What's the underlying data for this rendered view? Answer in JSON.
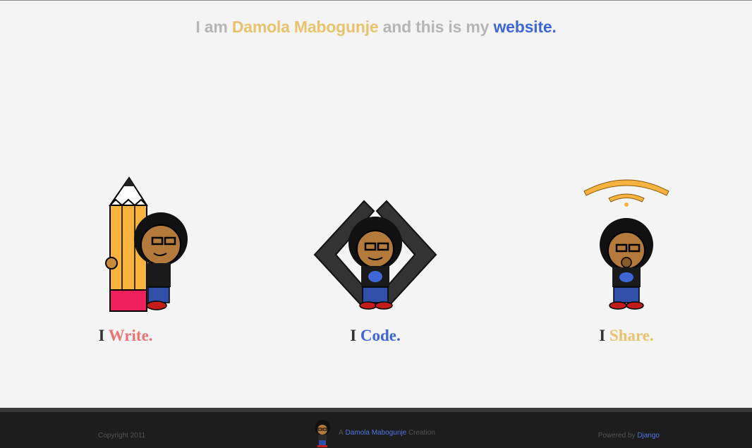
{
  "header": {
    "prefix": "I am",
    "name": "Damola Mabogunje",
    "middle": "and this is my",
    "link": "website."
  },
  "features": [
    {
      "i": "I",
      "verb": "Write.",
      "color": "#ec7474",
      "icon": "pencil-icon"
    },
    {
      "i": "I",
      "verb": "Code.",
      "color": "#3f66d6",
      "icon": "code-brackets-icon"
    },
    {
      "i": "I",
      "verb": "Share.",
      "color": "#e8c26c",
      "icon": "broadcast-icon"
    }
  ],
  "footer": {
    "copyright": "Copyright 2011",
    "credit_prefix": "A",
    "credit_name": "Damola Mabogunje",
    "credit_suffix": "Creation",
    "powered_prefix": "Powered by",
    "powered_link": "Django"
  }
}
